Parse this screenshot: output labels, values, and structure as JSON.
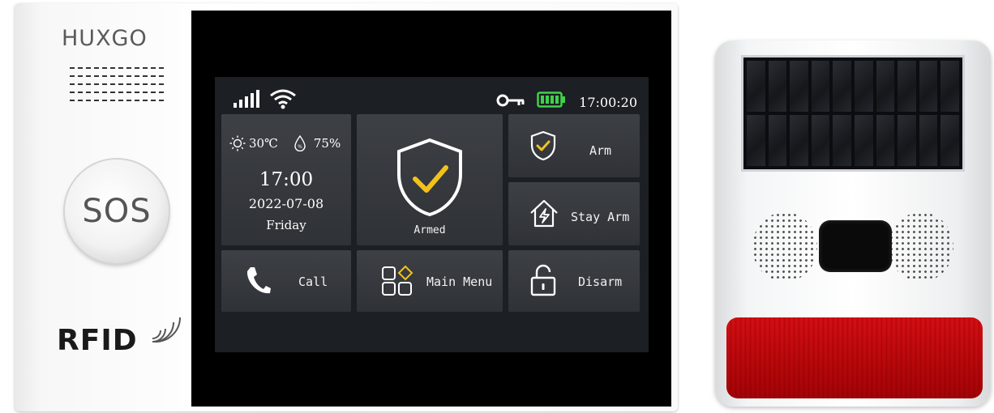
{
  "device": {
    "brand": "HUXGO",
    "sos_label": "SOS",
    "rfid_label": "RFID"
  },
  "screen": {
    "status_bar": {
      "icons": [
        "signal-icon",
        "wifi-icon",
        "key-icon",
        "battery-icon"
      ],
      "time": "17:00:20",
      "battery_color": "#3fd14a"
    },
    "weather": {
      "temperature": "30℃",
      "humidity": "75%",
      "time": "17:00",
      "date": "2022-07-08",
      "day": "Friday"
    },
    "status": {
      "label": "Armed",
      "icon": "shield-check-icon",
      "accent": "#f2c21b"
    },
    "buttons": {
      "arm": "Arm",
      "stay_arm": "Stay Arm",
      "disarm": "Disarm",
      "call": "Call",
      "main_menu": "Main Menu"
    },
    "colors": {
      "background": "#1c1f24",
      "tile": "#35383d",
      "text": "#ffffff"
    }
  }
}
